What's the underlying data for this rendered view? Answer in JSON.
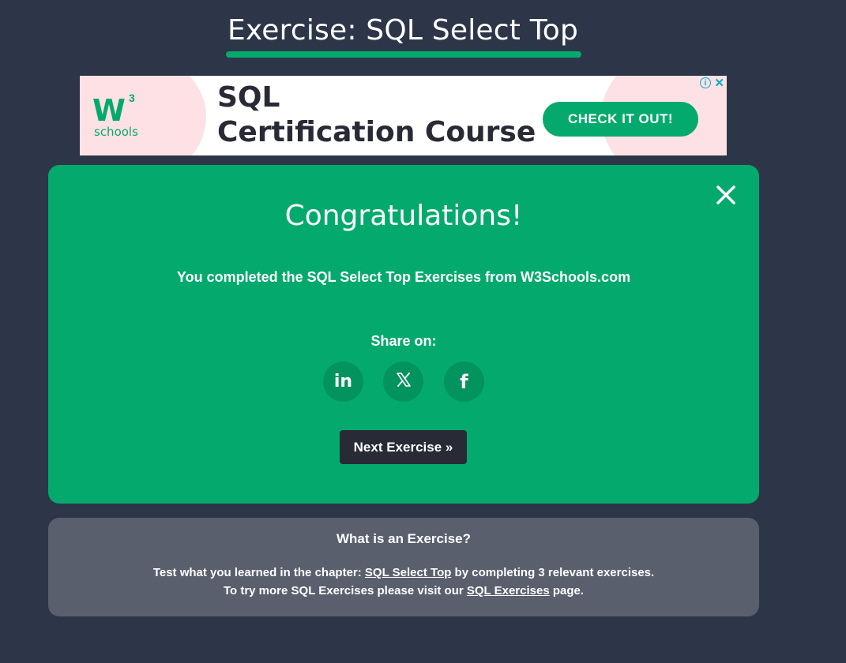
{
  "page": {
    "title": "Exercise: SQL Select Top"
  },
  "ad": {
    "logo_mark": "W",
    "logo_sup": "3",
    "logo_text": "schools",
    "headline_line1": "SQL",
    "headline_line2": "Certification Course",
    "cta_label": "CHECK IT OUT!",
    "info_icon": "info-icon",
    "close_icon": "close-icon"
  },
  "modal": {
    "title": "Congratulations!",
    "message": "You completed the SQL Select Top Exercises from W3Schools.com",
    "share_label": "Share on:",
    "share_buttons": [
      {
        "name": "linkedin",
        "icon": "linkedin-icon",
        "glyph": "in"
      },
      {
        "name": "x",
        "icon": "x-icon"
      },
      {
        "name": "facebook",
        "icon": "facebook-icon",
        "glyph": "f"
      }
    ],
    "next_label": "Next Exercise »"
  },
  "info": {
    "title": "What is an Exercise?",
    "line1_prefix": "Test what you learned in the chapter: ",
    "line1_link": "SQL Select Top",
    "line1_suffix": " by completing 3 relevant exercises.",
    "line2_prefix": "To try more SQL Exercises please visit our ",
    "line2_link": "SQL Exercises",
    "line2_suffix": " page."
  },
  "colors": {
    "background": "#2d3548",
    "accent": "#04aa6d",
    "modal_share_circle": "#03935e",
    "dark_button": "#282a35",
    "info_box": "#5a5f6e",
    "ad_pink": "#fde1e5"
  }
}
